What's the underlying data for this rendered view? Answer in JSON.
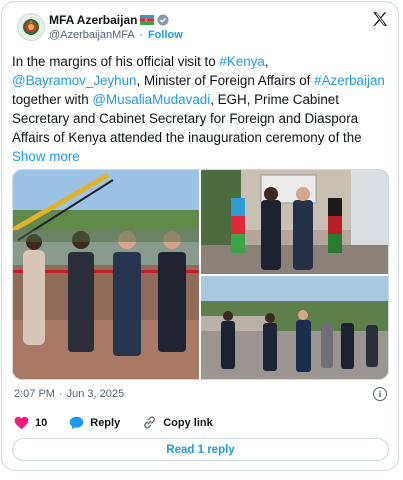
{
  "account": {
    "name": "MFA Azerbaijan",
    "handle": "@AzerbaijanMFA",
    "separator": "·",
    "follow_label": "Follow"
  },
  "tweet": {
    "segments": [
      {
        "text": "In the margins of his official visit to ",
        "link": false
      },
      {
        "text": "#Kenya",
        "link": true
      },
      {
        "text": ", ",
        "link": false
      },
      {
        "text": "@Bayramov_Jeyhun",
        "link": true
      },
      {
        "text": ", Minister of Foreign Affairs of ",
        "link": false
      },
      {
        "text": "#Azerbaijan",
        "link": true
      },
      {
        "text": " together with ",
        "link": false
      },
      {
        "text": "@MusaliaMudavadi",
        "link": true
      },
      {
        "text": ", EGH, Prime Cabinet Secretary and Cabinet Secretary for Foreign and Diaspora Affairs of Kenya attended the inauguration ceremony of the ",
        "link": false
      }
    ],
    "show_more": "Show more"
  },
  "meta": {
    "time": "2:07 PM",
    "separator": "·",
    "date": "Jun 3, 2025"
  },
  "actions": {
    "likes": "10",
    "reply_label": "Reply",
    "copy_label": "Copy link"
  },
  "read_reply_label": "Read 1 reply",
  "colors": {
    "link": "#1d9bf0",
    "like": "#f91880",
    "border": "#cfd9de",
    "muted": "#536471"
  }
}
